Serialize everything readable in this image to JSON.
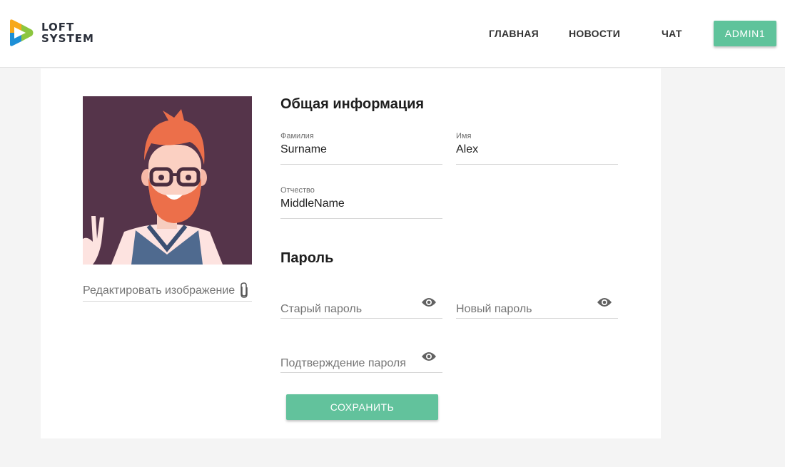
{
  "brand": {
    "line1": "LOFT",
    "line2": "SYSTEM"
  },
  "nav": {
    "home": "ГЛАВНАЯ",
    "news": "НОВОСТИ",
    "chat": "ЧАТ",
    "user": "ADMIN1"
  },
  "avatar": {
    "edit_label": "Редактировать изображение",
    "edit_icon": "paperclip-icon"
  },
  "general": {
    "title": "Общая информация",
    "surname": {
      "label": "Фамилия",
      "value": "Surname"
    },
    "name": {
      "label": "Имя",
      "value": "Alex"
    },
    "middlename": {
      "label": "Отчество",
      "value": "MiddleName"
    }
  },
  "password": {
    "title": "Пароль",
    "old_placeholder": "Старый пароль",
    "new_placeholder": "Новый пароль",
    "confirm_placeholder": "Подтверждение пароля",
    "toggle_icon": "eye-icon"
  },
  "save_label": "СОХРАНИТЬ",
  "colors": {
    "accent": "#62c29c",
    "avatar_bg": "#55344a",
    "page_bg": "#f4f4f4"
  }
}
